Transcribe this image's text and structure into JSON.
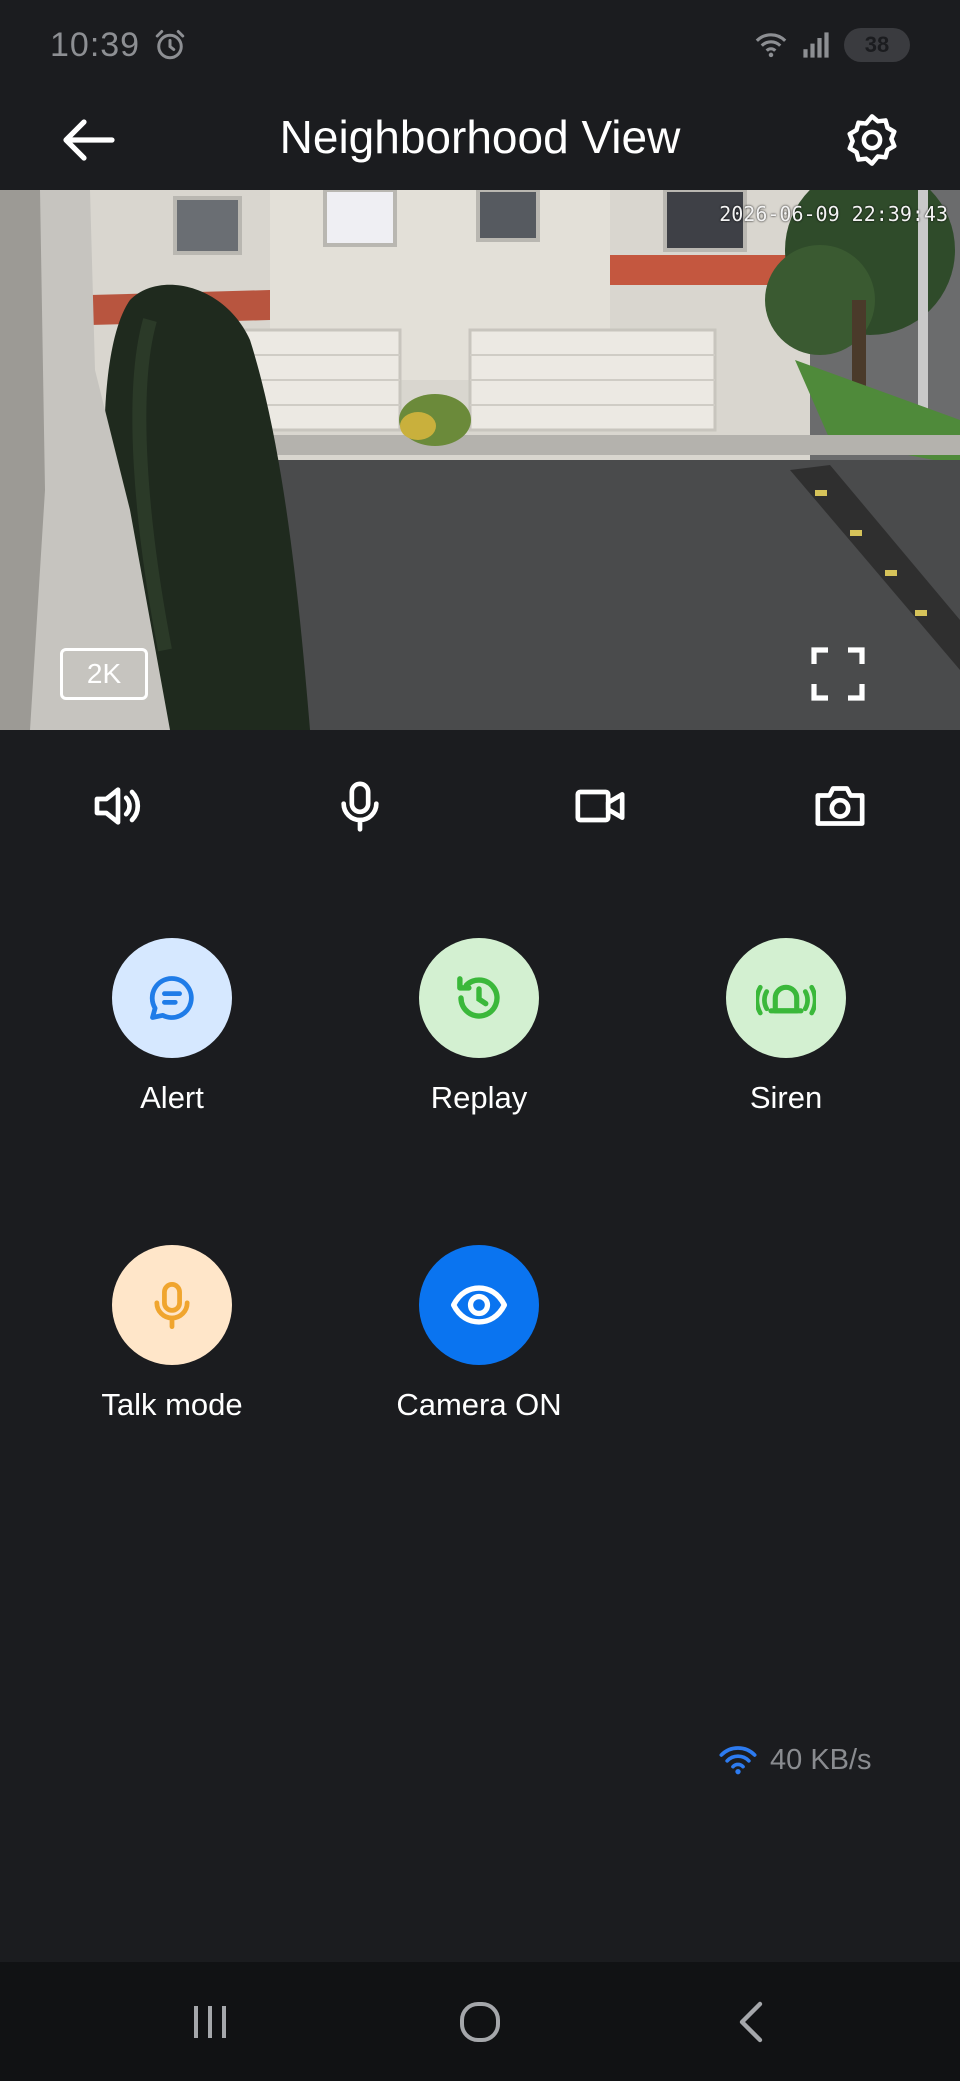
{
  "status_bar": {
    "time": "10:39",
    "battery": "38",
    "icons": [
      "alarm-icon",
      "wifi-icon",
      "signal-icon",
      "battery-icon"
    ]
  },
  "header": {
    "title": "Neighborhood View",
    "back_icon": "arrow-left-icon",
    "settings_icon": "gear-icon"
  },
  "video": {
    "timestamp": "2026-06-09 22:39:43",
    "resolution": "2K",
    "fullscreen_icon": "fullscreen-icon"
  },
  "controls": [
    {
      "name": "speaker-icon"
    },
    {
      "name": "microphone-icon"
    },
    {
      "name": "record-video-icon"
    },
    {
      "name": "snapshot-camera-icon"
    }
  ],
  "actions": [
    {
      "label": "Alert",
      "icon": "message-icon",
      "bg": "#d6e8ff",
      "fg": "#1f7ce8"
    },
    {
      "label": "Replay",
      "icon": "history-icon",
      "bg": "#d3f0d1",
      "fg": "#3ab83a"
    },
    {
      "label": "Siren",
      "icon": "siren-icon",
      "bg": "#d3f0d1",
      "fg": "#3ab83a"
    },
    {
      "label": "Talk mode",
      "icon": "microphone-icon",
      "bg": "#ffe6c9",
      "fg": "#f0a52e"
    },
    {
      "label": "Camera ON",
      "icon": "eye-icon",
      "bg": "#0a74f0",
      "fg": "#ffffff"
    }
  ],
  "network": {
    "speed": "40 KB/s",
    "icon": "wifi-icon",
    "icon_color": "#2d7bf0"
  },
  "navbar": {
    "items": [
      "recent-apps-icon",
      "home-icon",
      "back-icon"
    ]
  }
}
